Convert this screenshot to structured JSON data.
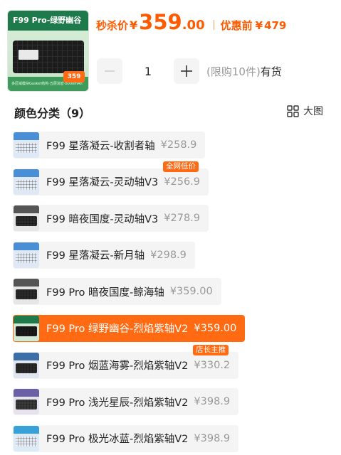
{
  "product": {
    "thumb_title": "F99 Pro-绿野幽谷",
    "thumb_footer": "多区域模块Gasket结构·五层消音·8000mAh",
    "thumb_price": "359"
  },
  "price": {
    "flash_label": "秒杀价",
    "currency": "¥",
    "flash_int": "359",
    "flash_dec": ".00",
    "pre_label": "优惠前",
    "pre_value": "479"
  },
  "quantity": {
    "value": "1",
    "limit_text": "(限购10件)",
    "stock_text": "有货"
  },
  "section": {
    "title": "颜色分类（9）",
    "view_toggle": "大图"
  },
  "variants": [
    {
      "name": "F99 星落凝云-收割者轴",
      "price": "¥258.9",
      "badge": "",
      "theme": "#4a8fd6",
      "kb": "#e8eef7",
      "bg": "#dfe9f6"
    },
    {
      "name": "F99 星落凝云-灵动轴V3",
      "price": "¥256.9",
      "badge": "全网低价",
      "theme": "#4a8fd6",
      "kb": "#e8eef7",
      "bg": "#dfe9f6"
    },
    {
      "name": "F99 暗夜国度-灵动轴V3",
      "price": "¥278.9",
      "badge": "",
      "theme": "#555555",
      "kb": "#2b2b2b",
      "bg": "#e6e6e6"
    },
    {
      "name": "F99 星落凝云-新月轴",
      "price": "¥298.9",
      "badge": "",
      "theme": "#4a8fd6",
      "kb": "#e8eef7",
      "bg": "#dfe9f6"
    },
    {
      "name": "F99 Pro 暗夜国度-鲸海轴",
      "price": "¥359.00",
      "badge": "",
      "theme": "#555555",
      "kb": "#2b2b2b",
      "bg": "#e6e6e6"
    },
    {
      "name": "F99 Pro 绿野幽谷-烈焰紫轴V2",
      "price": "¥359.00",
      "badge": "",
      "theme": "#1f7a4b",
      "kb": "#1c1c1c",
      "bg": "#d2ead3",
      "selected": true
    },
    {
      "name": "F99 Pro 烟蓝海雾-烈焰紫轴V2",
      "price": "¥330.2",
      "badge": "店长主推",
      "theme": "#3c6fa8",
      "kb": "#2b2b2b",
      "bg": "#dfe6ef"
    },
    {
      "name": "F99 Pro 浅光星辰-烈焰紫轴V2",
      "price": "¥398.9",
      "badge": "",
      "theme": "#6b5fa6",
      "kb": "#3a3a3a",
      "bg": "#e6e3ef"
    },
    {
      "name": "F99 Pro 极光冰蓝-烈焰紫轴V2",
      "price": "¥398.9",
      "badge": "",
      "theme": "#3aa0d8",
      "kb": "#e8eef7",
      "bg": "#dcecf6"
    }
  ]
}
